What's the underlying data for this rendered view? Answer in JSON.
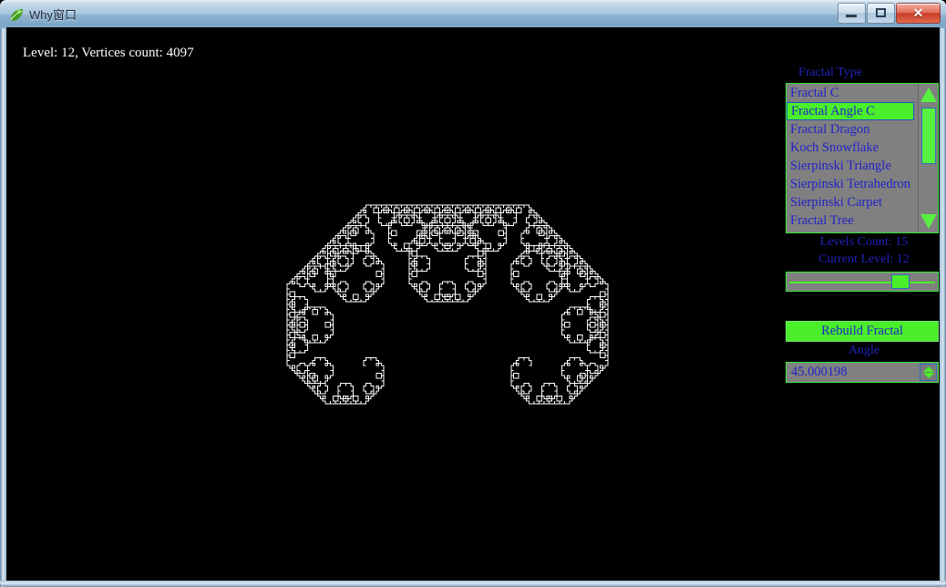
{
  "window": {
    "title": "Why窗口",
    "icon": "app-leaf-icon",
    "buttons": {
      "minimize": "minimize",
      "maximize": "maximize",
      "close": "✕"
    }
  },
  "canvas": {
    "status": "Level: 12, Vertices count: 4097",
    "background_color": "#000000",
    "stroke_color": "#ffffff"
  },
  "panel": {
    "fractal_type_label": "Fractal Type",
    "fractal_types": [
      "Fractal C",
      "Fractal Angle C",
      "Fractal Dragon",
      "Koch Snowflake",
      "Sierpinski Triangle",
      "Sierpinski Tetrahedron",
      "Sierpinski Carpet",
      "Fractal Tree"
    ],
    "selected_fractal_type": "Fractal Angle C",
    "levels_count_label": "Levels Count: 15",
    "current_level_label": "Current Level: 12",
    "level_slider": {
      "value": 12,
      "min": 0,
      "max": 15,
      "percent": 80
    },
    "rebuild_button": "Rebuild Fractal",
    "angle_label": "Angle",
    "angle_value": "45.000198",
    "colors": {
      "text_blue": "#2222c8",
      "accent_green": "#4aee2a",
      "control_gray": "#808080"
    }
  },
  "fractal_data": {
    "type": "levy-c-curve",
    "level": 12,
    "vertices_count": 4097,
    "angle_degrees": 45.000198
  }
}
